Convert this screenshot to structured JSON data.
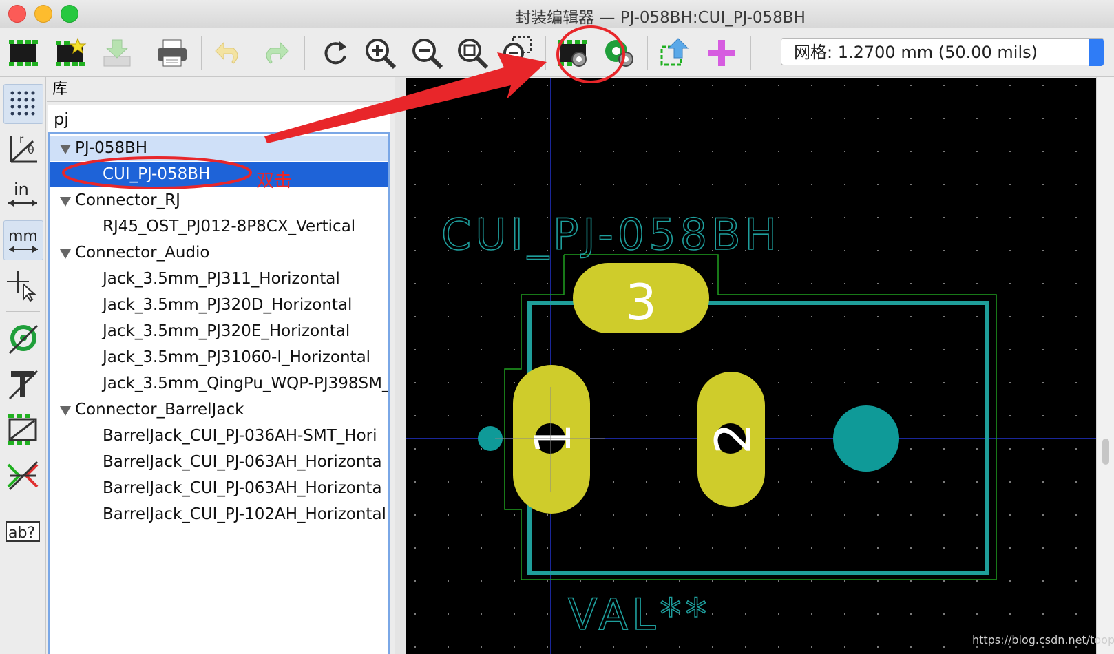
{
  "window": {
    "title": "封装编辑器 — PJ-058BH:CUI_PJ-058BH"
  },
  "toolbar": {
    "buttons": [
      {
        "name": "new-footprint-icon"
      },
      {
        "name": "new-footprint-wizard-icon"
      },
      {
        "name": "import-footprint-icon"
      },
      {
        "name": "print-icon"
      },
      {
        "name": "undo-icon"
      },
      {
        "name": "redo-icon"
      },
      {
        "name": "refresh-icon"
      },
      {
        "name": "zoom-in-icon"
      },
      {
        "name": "zoom-out-icon"
      },
      {
        "name": "zoom-fit-icon"
      },
      {
        "name": "zoom-selection-icon"
      },
      {
        "name": "footprint-properties-icon"
      },
      {
        "name": "pad-settings-icon"
      },
      {
        "name": "check-footprint-icon"
      },
      {
        "name": "insert-footprint-icon"
      }
    ],
    "grid_label": "网格: 1.2700 mm (50.00 mils)"
  },
  "left_toolbar": [
    {
      "name": "grid-dots-icon"
    },
    {
      "name": "polar-coords-icon",
      "label": "r θ"
    },
    {
      "name": "units-inch-icon",
      "label": "in"
    },
    {
      "name": "units-mm-icon",
      "label": "mm"
    },
    {
      "name": "cursor-shape-icon"
    },
    {
      "name": "pad-sketch-icon"
    },
    {
      "name": "text-sketch-icon"
    },
    {
      "name": "graphic-sketch-icon"
    },
    {
      "name": "high-contrast-icon"
    },
    {
      "name": "search-text-icon",
      "label": "ab?"
    }
  ],
  "library": {
    "header": "库",
    "search_value": "pj",
    "tree": [
      {
        "type": "lib",
        "label": "PJ-058BH",
        "state": "parent-selected"
      },
      {
        "type": "fp",
        "label": "CUI_PJ-058BH",
        "state": "selected"
      },
      {
        "type": "lib",
        "label": "Connector_RJ"
      },
      {
        "type": "fp",
        "label": "RJ45_OST_PJ012-8P8CX_Vertical"
      },
      {
        "type": "lib",
        "label": "Connector_Audio"
      },
      {
        "type": "fp",
        "label": "Jack_3.5mm_PJ311_Horizontal"
      },
      {
        "type": "fp",
        "label": "Jack_3.5mm_PJ320D_Horizontal"
      },
      {
        "type": "fp",
        "label": "Jack_3.5mm_PJ320E_Horizontal"
      },
      {
        "type": "fp",
        "label": "Jack_3.5mm_PJ31060-I_Horizontal"
      },
      {
        "type": "fp",
        "label": "Jack_3.5mm_QingPu_WQP-PJ398SM_"
      },
      {
        "type": "lib",
        "label": "Connector_BarrelJack"
      },
      {
        "type": "fp",
        "label": "BarrelJack_CUI_PJ-036AH-SMT_Hori"
      },
      {
        "type": "fp",
        "label": "BarrelJack_CUI_PJ-063AH_Horizonta"
      },
      {
        "type": "fp",
        "label": "BarrelJack_CUI_PJ-063AH_Horizonta"
      },
      {
        "type": "fp",
        "label": "BarrelJack_CUI_PJ-102AH_Horizontal"
      }
    ]
  },
  "canvas": {
    "reference_text": "CUI_PJ-058BH",
    "value_text": "VAL**",
    "pads": [
      {
        "number": "1",
        "shape": "oval-vertical"
      },
      {
        "number": "2",
        "shape": "oval-vertical"
      },
      {
        "number": "3",
        "shape": "oval-horizontal"
      }
    ],
    "colors": {
      "background": "#000000",
      "pad": "#cfcc2b",
      "courtyard": "#1f9e9a",
      "fab": "#20a020",
      "text": "#1e9e9c",
      "axis": "#2233cc"
    }
  },
  "annotation": {
    "label": "双击",
    "color": "#e8262a"
  },
  "watermark": "https://blog.csdn.net/toopoo"
}
